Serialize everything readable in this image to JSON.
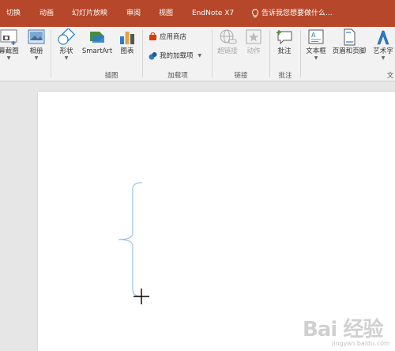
{
  "tabs": [
    {
      "label": "切换"
    },
    {
      "label": "动画"
    },
    {
      "label": "幻灯片放映"
    },
    {
      "label": "审阅"
    },
    {
      "label": "视图"
    },
    {
      "label": "EndNote X7"
    }
  ],
  "tell_me": "告诉我您想要做什么...",
  "ribbon": {
    "screenshot_label": "幕截图",
    "album_label": "相册",
    "shapes_label": "形状",
    "smartart_label": "SmartArt",
    "chart_label": "图表",
    "store_label": "应用商店",
    "my_addins_label": "我的加载项",
    "hyperlink_label": "超链接",
    "action_label": "动作",
    "comment_label": "批注",
    "textbox_label": "文本框",
    "header_footer_label": "页眉和页脚",
    "wordart_label": "艺术字"
  },
  "groups": {
    "illustrations": "插图",
    "addins": "加载项",
    "links": "链接",
    "comments": "批注",
    "text": "文"
  },
  "watermark": {
    "main": "Bai 经验",
    "sub": "jingyan.baidu.com"
  },
  "colors": {
    "accent": "#b7472a",
    "ribbon_bg": "#f2f2f2",
    "workspace_bg": "#e6e6e6",
    "brace": "#9dc3e6"
  }
}
